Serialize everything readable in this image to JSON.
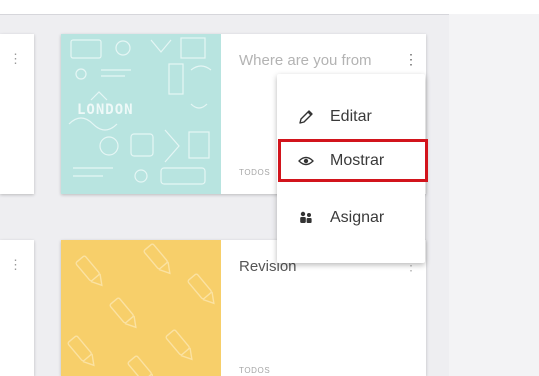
{
  "cards": [
    {
      "title": "Where are you from",
      "tag": "TODOS",
      "cover_text": "LONDON",
      "cover_color": "#b8e4e0"
    },
    {
      "title": "Revision",
      "tag": "TODOS",
      "cover_color": "#f7cf6a"
    }
  ],
  "menu": {
    "items": [
      {
        "label": "Editar",
        "icon": "pencil-icon"
      },
      {
        "label": "Mostrar",
        "icon": "eye-icon",
        "highlighted": true
      },
      {
        "label": "Asignar",
        "icon": "assign-icon"
      }
    ]
  },
  "colors": {
    "highlight": "#d2141c",
    "background": "#eeeef1"
  }
}
